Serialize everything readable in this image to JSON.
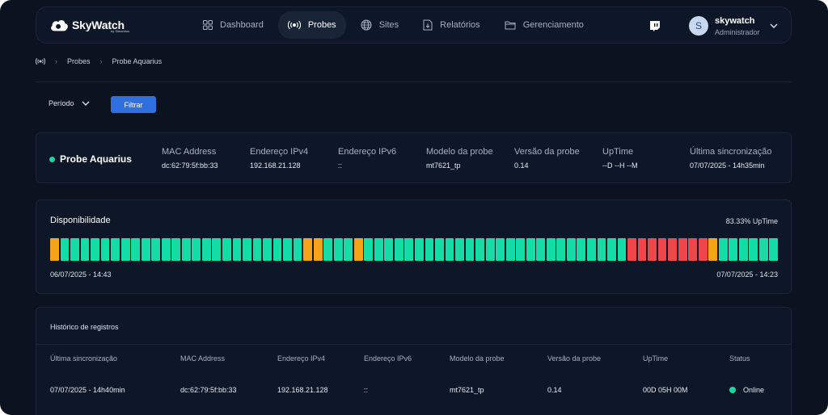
{
  "brand": {
    "name": "SkyWatch",
    "tagline": "by Simandus"
  },
  "nav": {
    "items": [
      {
        "label": "Dashboard",
        "icon": "grid-icon",
        "active": false
      },
      {
        "label": "Probes",
        "icon": "broadcast-icon",
        "active": true
      },
      {
        "label": "Sites",
        "icon": "globe-icon",
        "active": false
      },
      {
        "label": "Relatórios",
        "icon": "report-icon",
        "active": false
      },
      {
        "label": "Gerenciamento",
        "icon": "folder-icon",
        "active": false
      }
    ]
  },
  "user": {
    "avatar_letter": "S",
    "name": "skywatch",
    "role": "Administrador"
  },
  "breadcrumb": {
    "items": [
      "Probes",
      "Probe Aquarius"
    ]
  },
  "filter": {
    "period_label": "Período",
    "button_label": "Filtrar"
  },
  "probe": {
    "name": "Probe Aquarius",
    "status_color": "#19d7a3",
    "fields": [
      {
        "label": "MAC Address",
        "value": "dc:62:79:5f:bb:33"
      },
      {
        "label": "Endereço IPv4",
        "value": "192.168.21.128"
      },
      {
        "label": "Endereço IPv6",
        "value": "::"
      },
      {
        "label": "Modelo da probe",
        "value": "mt7621_tp"
      },
      {
        "label": "Versão da probe",
        "value": "0.14"
      },
      {
        "label": "UpTime",
        "value": "--D --H --M"
      },
      {
        "label": "Última sincronização",
        "value": "07/07/2025 - 14h35min"
      }
    ]
  },
  "availability": {
    "title": "Disponibilidade",
    "uptime_text": "83.33% UpTime",
    "start": "06/07/2025 - 14:43",
    "end": "07/07/2025 - 14:23",
    "colors": {
      "up": "#14dca5",
      "warn": "#f5a31b",
      "down": "#f0454a"
    },
    "segments": [
      "warn",
      "up",
      "up",
      "up",
      "up",
      "up",
      "up",
      "up",
      "up",
      "up",
      "up",
      "up",
      "up",
      "up",
      "up",
      "up",
      "up",
      "up",
      "up",
      "up",
      "up",
      "up",
      "up",
      "up",
      "up",
      "warn",
      "warn",
      "up",
      "up",
      "up",
      "warn",
      "up",
      "up",
      "up",
      "up",
      "up",
      "up",
      "up",
      "up",
      "up",
      "up",
      "up",
      "up",
      "up",
      "up",
      "up",
      "up",
      "up",
      "up",
      "up",
      "up",
      "up",
      "up",
      "up",
      "up",
      "up",
      "up",
      "up",
      "up",
      "up",
      "up",
      "up",
      "up",
      "up",
      "up",
      "up",
      "up",
      "up",
      "up",
      "up",
      "up",
      "up",
      "up",
      "up",
      "up",
      "up",
      "up",
      "up",
      "up",
      "up",
      "up",
      "up",
      "up",
      "up",
      "up",
      "up",
      "up",
      "up",
      "up",
      "up",
      "up",
      "up",
      "up",
      "up",
      "up",
      "up",
      "up",
      "up",
      "up",
      "up",
      "up",
      "up",
      "up",
      "up",
      "up",
      "up",
      "up",
      "up",
      "up",
      "up",
      "up",
      "up",
      "up",
      "up",
      "up",
      "up",
      "up",
      "up",
      "up",
      "up",
      "up",
      "up",
      "up",
      "up",
      "up",
      "up",
      "up",
      "up",
      "up",
      "up",
      "up",
      "up",
      "up",
      "up",
      "up",
      "up",
      "up",
      "up",
      "up",
      "up",
      "up",
      "up",
      "up",
      "up",
      "up",
      "up",
      "up",
      "up",
      "up",
      "up",
      "up",
      "up",
      "up",
      "up"
    ]
  },
  "history": {
    "title": "Histórico de registros",
    "columns": [
      "Última sincronização",
      "MAC Address",
      "Endereço IPv4",
      "Endereço IPv6",
      "Modelo da probe",
      "Versão da probe",
      "UpTime",
      "Status"
    ],
    "rows": [
      [
        "07/07/2025 - 14h40min",
        "dc:62:79:5f:bb:33",
        "192.168.21.128",
        "::",
        "mt7621_tp",
        "0.14",
        "00D 05H 00M",
        "Online"
      ]
    ]
  }
}
